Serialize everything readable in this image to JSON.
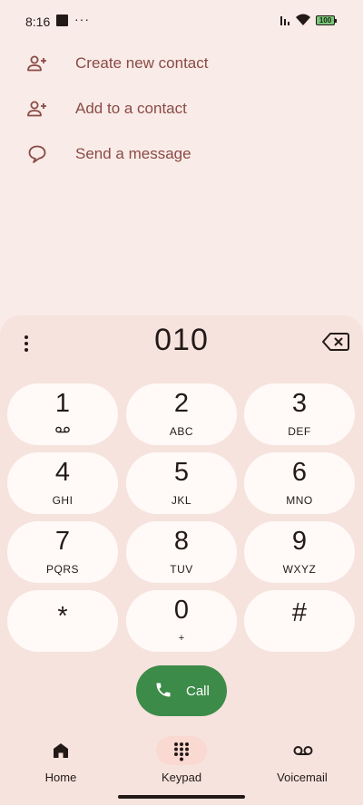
{
  "status_bar": {
    "time": "8:16",
    "more": "···",
    "battery": "100"
  },
  "menu": {
    "items": [
      {
        "label": "Create new contact",
        "icon": "person-add-icon"
      },
      {
        "label": "Add to a contact",
        "icon": "person-add-icon"
      },
      {
        "label": "Send a message",
        "icon": "message-icon"
      }
    ]
  },
  "dialpad": {
    "number": "010",
    "keys": [
      {
        "digit": "1",
        "letters": ""
      },
      {
        "digit": "2",
        "letters": "ABC"
      },
      {
        "digit": "3",
        "letters": "DEF"
      },
      {
        "digit": "4",
        "letters": "GHI"
      },
      {
        "digit": "5",
        "letters": "JKL"
      },
      {
        "digit": "6",
        "letters": "MNO"
      },
      {
        "digit": "7",
        "letters": "PQRS"
      },
      {
        "digit": "8",
        "letters": "TUV"
      },
      {
        "digit": "9",
        "letters": "WXYZ"
      },
      {
        "digit": "*",
        "letters": ""
      },
      {
        "digit": "0",
        "letters": "+"
      },
      {
        "digit": "#",
        "letters": ""
      }
    ],
    "call_label": "Call"
  },
  "nav": {
    "items": [
      {
        "label": "Home",
        "icon": "home-icon"
      },
      {
        "label": "Keypad",
        "icon": "dialpad-icon",
        "active": true
      },
      {
        "label": "Voicemail",
        "icon": "voicemail-icon"
      }
    ]
  },
  "colors": {
    "background": "#f9ebe7",
    "sheet": "#f6e3de",
    "key": "#fffaf7",
    "menu_text": "#8a4b46",
    "call_green": "#3d8b49",
    "nav_active": "#fbd9d3"
  }
}
